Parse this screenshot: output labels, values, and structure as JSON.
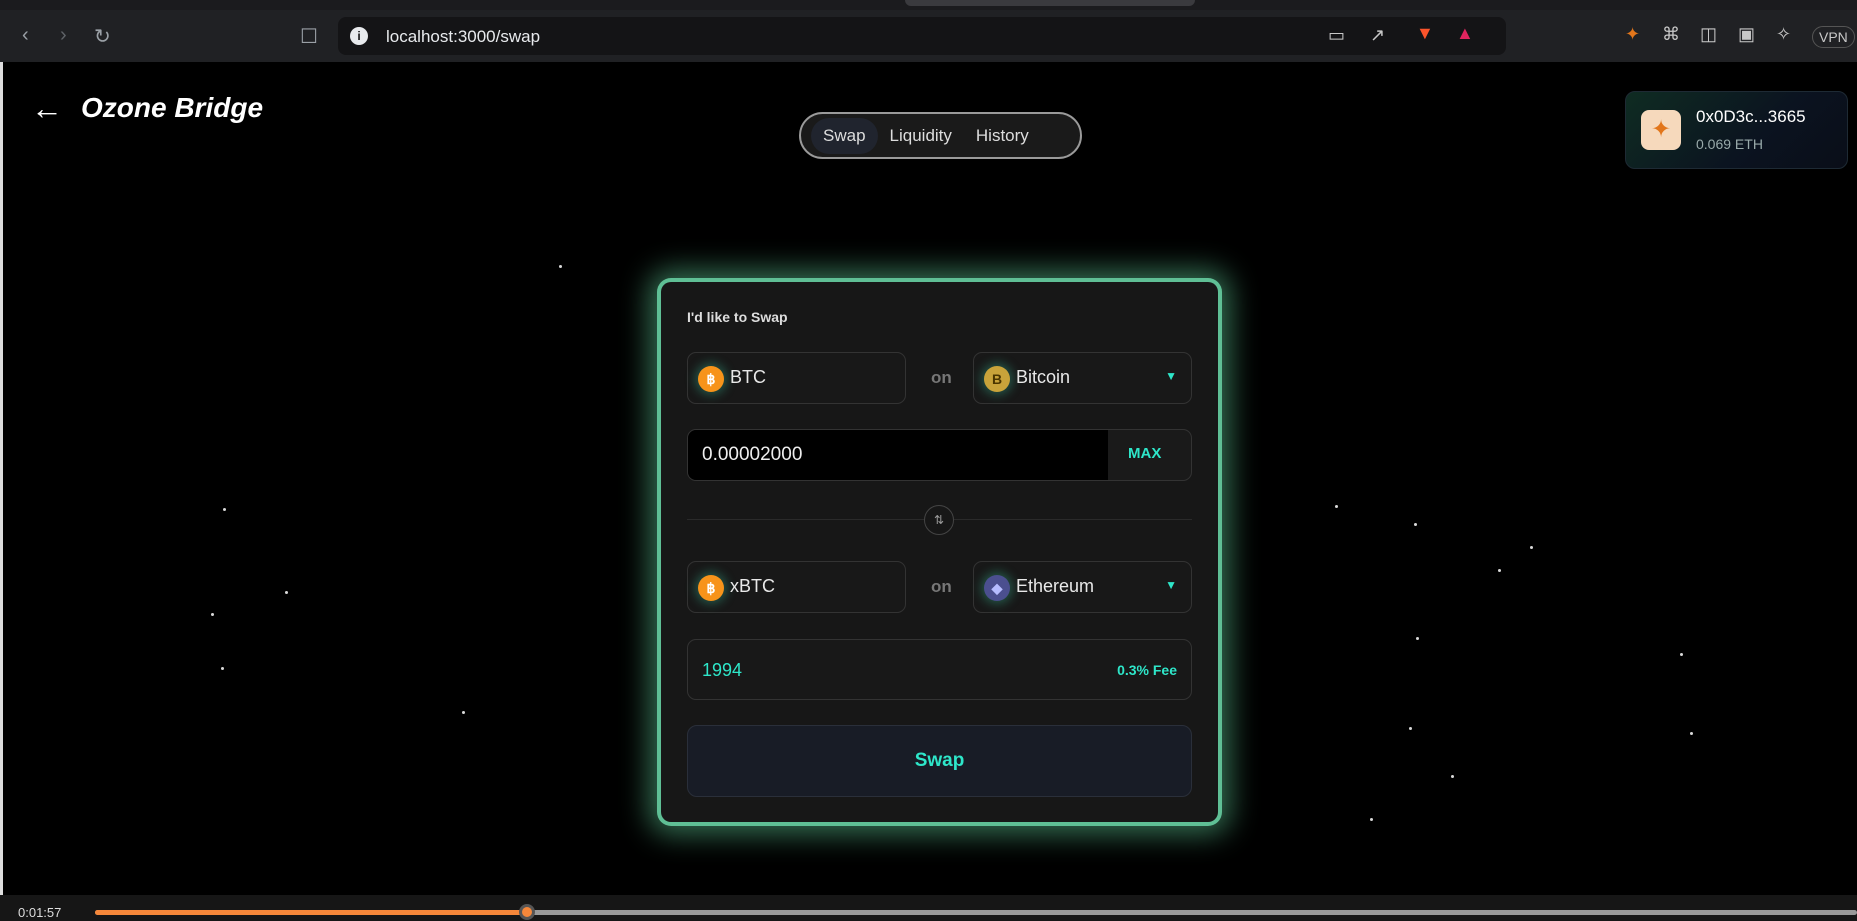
{
  "browser": {
    "url": "localhost:3000/swap",
    "vpn_label": "VPN"
  },
  "header": {
    "title": "Ozone Bridge",
    "tabs": [
      {
        "label": "Swap",
        "active": true
      },
      {
        "label": "Liquidity",
        "active": false
      },
      {
        "label": "History",
        "active": false
      }
    ]
  },
  "wallet": {
    "address": "0x0D3c...3665",
    "balance": "0.069 ETH"
  },
  "swap": {
    "heading": "I'd like to Swap",
    "from": {
      "token": "BTC",
      "connector": "on",
      "chain": "Bitcoin",
      "amount": "0.00002000",
      "max_label": "MAX"
    },
    "to": {
      "token": "xBTC",
      "connector": "on",
      "chain": "Ethereum",
      "amount": "1994",
      "fee": "0.3% Fee"
    },
    "button_label": "Swap"
  },
  "video": {
    "time": "0:01:57",
    "progress": 0.245
  },
  "colors": {
    "accent": "#2ee6c9",
    "glow": "#5fbf95",
    "progress": "#f5873a"
  }
}
